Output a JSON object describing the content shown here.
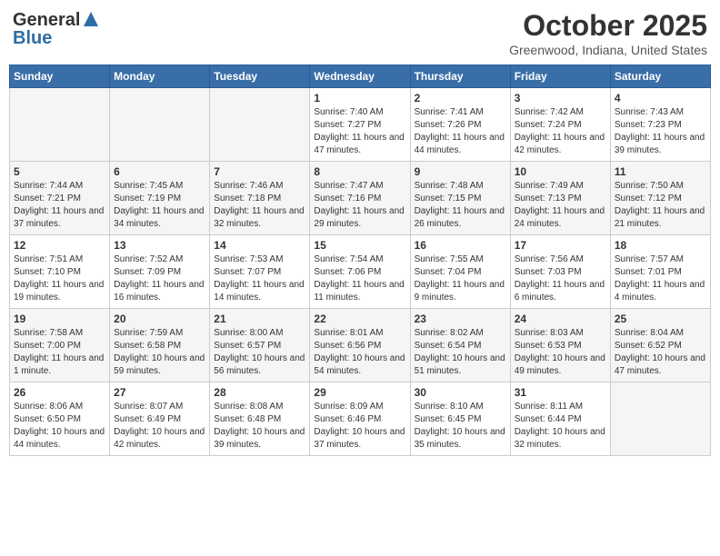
{
  "header": {
    "logo_general": "General",
    "logo_blue": "Blue",
    "title": "October 2025",
    "location": "Greenwood, Indiana, United States"
  },
  "weekdays": [
    "Sunday",
    "Monday",
    "Tuesday",
    "Wednesday",
    "Thursday",
    "Friday",
    "Saturday"
  ],
  "weeks": [
    [
      {
        "day": "",
        "info": ""
      },
      {
        "day": "",
        "info": ""
      },
      {
        "day": "",
        "info": ""
      },
      {
        "day": "1",
        "info": "Sunrise: 7:40 AM\nSunset: 7:27 PM\nDaylight: 11 hours and 47 minutes."
      },
      {
        "day": "2",
        "info": "Sunrise: 7:41 AM\nSunset: 7:26 PM\nDaylight: 11 hours and 44 minutes."
      },
      {
        "day": "3",
        "info": "Sunrise: 7:42 AM\nSunset: 7:24 PM\nDaylight: 11 hours and 42 minutes."
      },
      {
        "day": "4",
        "info": "Sunrise: 7:43 AM\nSunset: 7:23 PM\nDaylight: 11 hours and 39 minutes."
      }
    ],
    [
      {
        "day": "5",
        "info": "Sunrise: 7:44 AM\nSunset: 7:21 PM\nDaylight: 11 hours and 37 minutes."
      },
      {
        "day": "6",
        "info": "Sunrise: 7:45 AM\nSunset: 7:19 PM\nDaylight: 11 hours and 34 minutes."
      },
      {
        "day": "7",
        "info": "Sunrise: 7:46 AM\nSunset: 7:18 PM\nDaylight: 11 hours and 32 minutes."
      },
      {
        "day": "8",
        "info": "Sunrise: 7:47 AM\nSunset: 7:16 PM\nDaylight: 11 hours and 29 minutes."
      },
      {
        "day": "9",
        "info": "Sunrise: 7:48 AM\nSunset: 7:15 PM\nDaylight: 11 hours and 26 minutes."
      },
      {
        "day": "10",
        "info": "Sunrise: 7:49 AM\nSunset: 7:13 PM\nDaylight: 11 hours and 24 minutes."
      },
      {
        "day": "11",
        "info": "Sunrise: 7:50 AM\nSunset: 7:12 PM\nDaylight: 11 hours and 21 minutes."
      }
    ],
    [
      {
        "day": "12",
        "info": "Sunrise: 7:51 AM\nSunset: 7:10 PM\nDaylight: 11 hours and 19 minutes."
      },
      {
        "day": "13",
        "info": "Sunrise: 7:52 AM\nSunset: 7:09 PM\nDaylight: 11 hours and 16 minutes."
      },
      {
        "day": "14",
        "info": "Sunrise: 7:53 AM\nSunset: 7:07 PM\nDaylight: 11 hours and 14 minutes."
      },
      {
        "day": "15",
        "info": "Sunrise: 7:54 AM\nSunset: 7:06 PM\nDaylight: 11 hours and 11 minutes."
      },
      {
        "day": "16",
        "info": "Sunrise: 7:55 AM\nSunset: 7:04 PM\nDaylight: 11 hours and 9 minutes."
      },
      {
        "day": "17",
        "info": "Sunrise: 7:56 AM\nSunset: 7:03 PM\nDaylight: 11 hours and 6 minutes."
      },
      {
        "day": "18",
        "info": "Sunrise: 7:57 AM\nSunset: 7:01 PM\nDaylight: 11 hours and 4 minutes."
      }
    ],
    [
      {
        "day": "19",
        "info": "Sunrise: 7:58 AM\nSunset: 7:00 PM\nDaylight: 11 hours and 1 minute."
      },
      {
        "day": "20",
        "info": "Sunrise: 7:59 AM\nSunset: 6:58 PM\nDaylight: 10 hours and 59 minutes."
      },
      {
        "day": "21",
        "info": "Sunrise: 8:00 AM\nSunset: 6:57 PM\nDaylight: 10 hours and 56 minutes."
      },
      {
        "day": "22",
        "info": "Sunrise: 8:01 AM\nSunset: 6:56 PM\nDaylight: 10 hours and 54 minutes."
      },
      {
        "day": "23",
        "info": "Sunrise: 8:02 AM\nSunset: 6:54 PM\nDaylight: 10 hours and 51 minutes."
      },
      {
        "day": "24",
        "info": "Sunrise: 8:03 AM\nSunset: 6:53 PM\nDaylight: 10 hours and 49 minutes."
      },
      {
        "day": "25",
        "info": "Sunrise: 8:04 AM\nSunset: 6:52 PM\nDaylight: 10 hours and 47 minutes."
      }
    ],
    [
      {
        "day": "26",
        "info": "Sunrise: 8:06 AM\nSunset: 6:50 PM\nDaylight: 10 hours and 44 minutes."
      },
      {
        "day": "27",
        "info": "Sunrise: 8:07 AM\nSunset: 6:49 PM\nDaylight: 10 hours and 42 minutes."
      },
      {
        "day": "28",
        "info": "Sunrise: 8:08 AM\nSunset: 6:48 PM\nDaylight: 10 hours and 39 minutes."
      },
      {
        "day": "29",
        "info": "Sunrise: 8:09 AM\nSunset: 6:46 PM\nDaylight: 10 hours and 37 minutes."
      },
      {
        "day": "30",
        "info": "Sunrise: 8:10 AM\nSunset: 6:45 PM\nDaylight: 10 hours and 35 minutes."
      },
      {
        "day": "31",
        "info": "Sunrise: 8:11 AM\nSunset: 6:44 PM\nDaylight: 10 hours and 32 minutes."
      },
      {
        "day": "",
        "info": ""
      }
    ]
  ]
}
